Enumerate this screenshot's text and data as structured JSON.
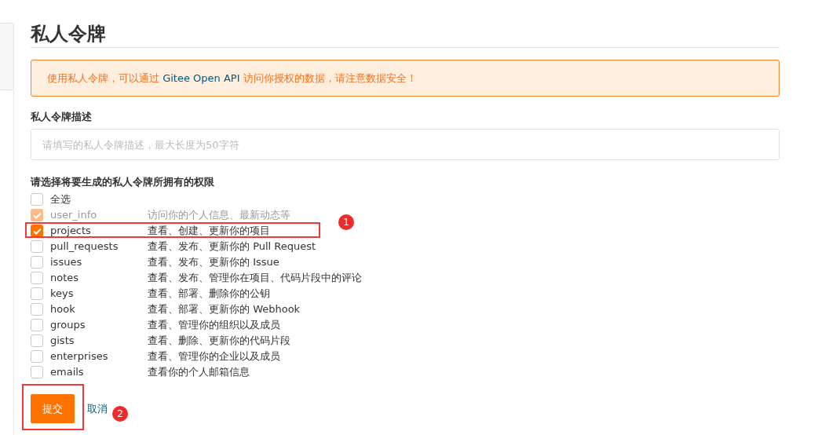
{
  "title": "私人令牌",
  "alert": {
    "parts": [
      {
        "text": "使用私人令牌，可以通过 ",
        "kind": "plain"
      },
      {
        "text": "Gitee Open API",
        "kind": "accent"
      },
      {
        "text": " 访问你授权的数据，请注意数据安全！",
        "kind": "plain"
      }
    ]
  },
  "description_field": {
    "label": "私人令牌描述",
    "placeholder": "请填写的私人令牌描述，最大长度为50字符"
  },
  "permissions": {
    "label": "请选择将要生成的私人令牌所拥有的权限",
    "select_all": {
      "label": "全选",
      "checked": false
    },
    "items": [
      {
        "name": "user_info",
        "description": "访问你的个人信息、最新动态等",
        "checked": true,
        "disabled": true
      },
      {
        "name": "projects",
        "description": "查看、创建、更新你的项目",
        "checked": true,
        "disabled": false
      },
      {
        "name": "pull_requests",
        "description": "查看、发布、更新你的 Pull Request",
        "checked": false,
        "disabled": false
      },
      {
        "name": "issues",
        "description": "查看、发布、更新你的 Issue",
        "checked": false,
        "disabled": false
      },
      {
        "name": "notes",
        "description": "查看、发布、管理你在项目、代码片段中的评论",
        "checked": false,
        "disabled": false
      },
      {
        "name": "keys",
        "description": "查看、部署、删除你的公钥",
        "checked": false,
        "disabled": false
      },
      {
        "name": "hook",
        "description": "查看、部署、更新你的 Webhook",
        "checked": false,
        "disabled": false
      },
      {
        "name": "groups",
        "description": "查看、管理你的组织以及成员",
        "checked": false,
        "disabled": false
      },
      {
        "name": "gists",
        "description": "查看、删除、更新你的代码片段",
        "checked": false,
        "disabled": false
      },
      {
        "name": "enterprises",
        "description": "查看、管理你的企业以及成员",
        "checked": false,
        "disabled": false
      },
      {
        "name": "emails",
        "description": "查看你的个人邮箱信息",
        "checked": false,
        "disabled": false
      }
    ]
  },
  "buttons": {
    "submit": "提交",
    "cancel": "取消"
  },
  "annotations": [
    {
      "number": "1"
    },
    {
      "number": "2"
    }
  ]
}
